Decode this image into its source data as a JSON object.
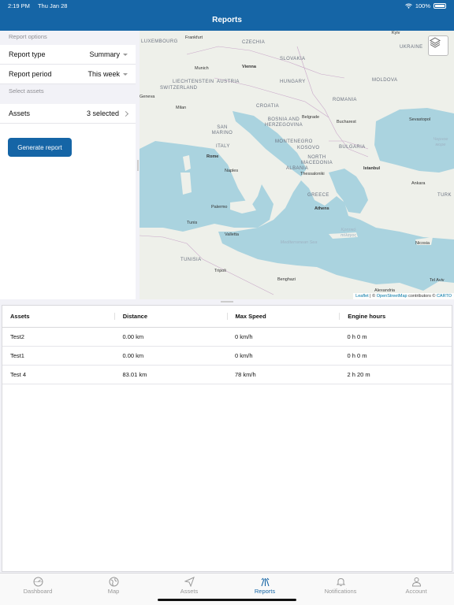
{
  "status_bar": {
    "time": "2:19 PM",
    "date": "Thu Jan 28",
    "battery": "100%"
  },
  "nav": {
    "title": "Reports"
  },
  "options": {
    "section_report_options": "Report options",
    "report_type_label": "Report type",
    "report_type_value": "Summary",
    "report_period_label": "Report period",
    "report_period_value": "This week",
    "section_select_assets": "Select assets",
    "assets_label": "Assets",
    "assets_value": "3 selected",
    "generate_button": "Generate report"
  },
  "map": {
    "countries": [
      "LUXEMBOURG",
      "CZECHIA",
      "UKRAINE",
      "SLOVAKIA",
      "AUSTRIA",
      "LIECHTENSTEIN",
      "SWITZERLAND",
      "HUNGARY",
      "MOLDOVA",
      "ROMANIA",
      "CROATIA",
      "BOSNIA AND HERZEGOVINA",
      "SAN MARINO",
      "MONTENEGRO",
      "KOSOVO",
      "BULGARIA",
      "ITALY",
      "NORTH MACEDONIA",
      "ALBANIA",
      "GREECE",
      "TUNISIA",
      "TURK"
    ],
    "cities": [
      "Frankfurt",
      "Kyiv",
      "Munich",
      "Vienna",
      "Geneva",
      "Milan",
      "Belgrade",
      "Bucharest",
      "Sevastopol",
      "Rome",
      "Naples",
      "Istanbul",
      "Thessaloniki",
      "Ankara",
      "Athens",
      "Palermo",
      "Tunis",
      "Valletta",
      "Nicosia",
      "Tripoli",
      "Benghazi",
      "Tel Aviv",
      "Alexandria"
    ],
    "seas": [
      "Черное море",
      "Κρητικό πέλαγος",
      "Mediterranean Sea"
    ],
    "attribution": {
      "leaflet": "Leaflet",
      "sep": " | © ",
      "osm": "OpenStreetMap",
      "mid": " contributors © ",
      "carto": "CARTO"
    }
  },
  "table": {
    "headers": [
      "Assets",
      "Distance",
      "Max Speed",
      "Engine hours"
    ],
    "rows": [
      [
        "Test2",
        "0.00 km",
        "0 km/h",
        "0 h 0 m"
      ],
      [
        "Test1",
        "0.00 km",
        "0 km/h",
        "0 h 0 m"
      ],
      [
        "Test 4",
        "83.01 km",
        "78 km/h",
        "2 h 20 m"
      ]
    ]
  },
  "tabs": [
    {
      "label": "Dashboard",
      "icon": "dashboard-icon"
    },
    {
      "label": "Map",
      "icon": "globe-icon"
    },
    {
      "label": "Assets",
      "icon": "send-icon"
    },
    {
      "label": "Reports",
      "icon": "reports-icon",
      "active": true
    },
    {
      "label": "Notifications",
      "icon": "bell-icon"
    },
    {
      "label": "Account",
      "icon": "person-icon"
    }
  ],
  "colors": {
    "primary": "#1565a6",
    "sea": "#aad3df",
    "land": "#eef0ea"
  }
}
